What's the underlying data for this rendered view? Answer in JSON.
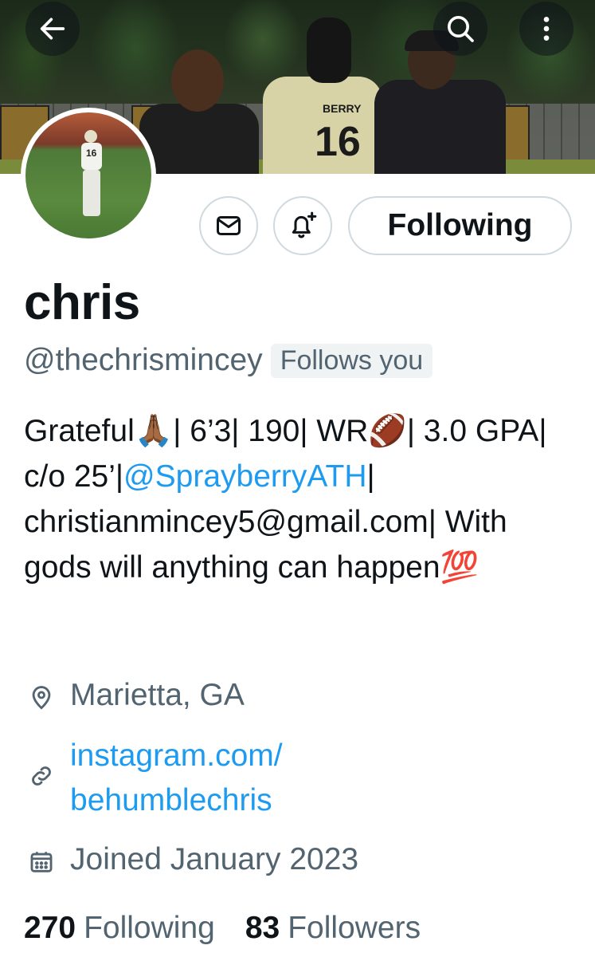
{
  "header": {
    "back_icon": "arrow-left-icon",
    "search_icon": "search-icon",
    "more_icon": "more-vertical-icon",
    "banner": {
      "jersey_text": "BERRY",
      "jersey_number": "16"
    }
  },
  "avatar": {
    "jersey_number": "16"
  },
  "actions": {
    "message_icon": "mail-icon",
    "notify_icon": "bell-plus-icon",
    "follow_label": "Following"
  },
  "profile": {
    "name": "chris",
    "handle": "@thechrismincey",
    "follows_you": "Follows you",
    "bio": {
      "part1": "Grateful🙏🏾| 6’3| 190| WR🏈| 3.0 GPA| c/o 25’|",
      "mention": "@SprayberryATH",
      "part2": "| christianmincey5@gmail.com| With gods will anything can happen💯"
    },
    "location": "Marietta, GA",
    "website_line1": "instagram.com/",
    "website_line2": "behumblechris",
    "joined": "Joined January 2023"
  },
  "stats": {
    "following_count": "270",
    "following_label": "Following",
    "followers_count": "83",
    "followers_label": "Followers"
  },
  "colors": {
    "accent": "#1d9bf0",
    "secondary_text": "#536471",
    "border": "#cfd9de"
  }
}
